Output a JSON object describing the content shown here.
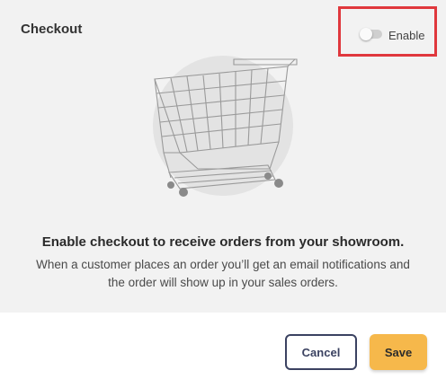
{
  "header": {
    "title": "Checkout"
  },
  "enable_toggle": {
    "label": "Enable",
    "state": "off"
  },
  "illustration": {
    "icon": "shopping-cart-icon"
  },
  "content": {
    "headline": "Enable checkout to receive orders from your showroom.",
    "line1": "When a customer places an order you’ll get an email notifications and",
    "line2": "the order will show up in your sales orders."
  },
  "footer": {
    "cancel_label": "Cancel",
    "save_label": "Save"
  },
  "colors": {
    "accent_save": "#f6b84b",
    "cancel_border": "#3b4261",
    "highlight": "#e0383d"
  }
}
